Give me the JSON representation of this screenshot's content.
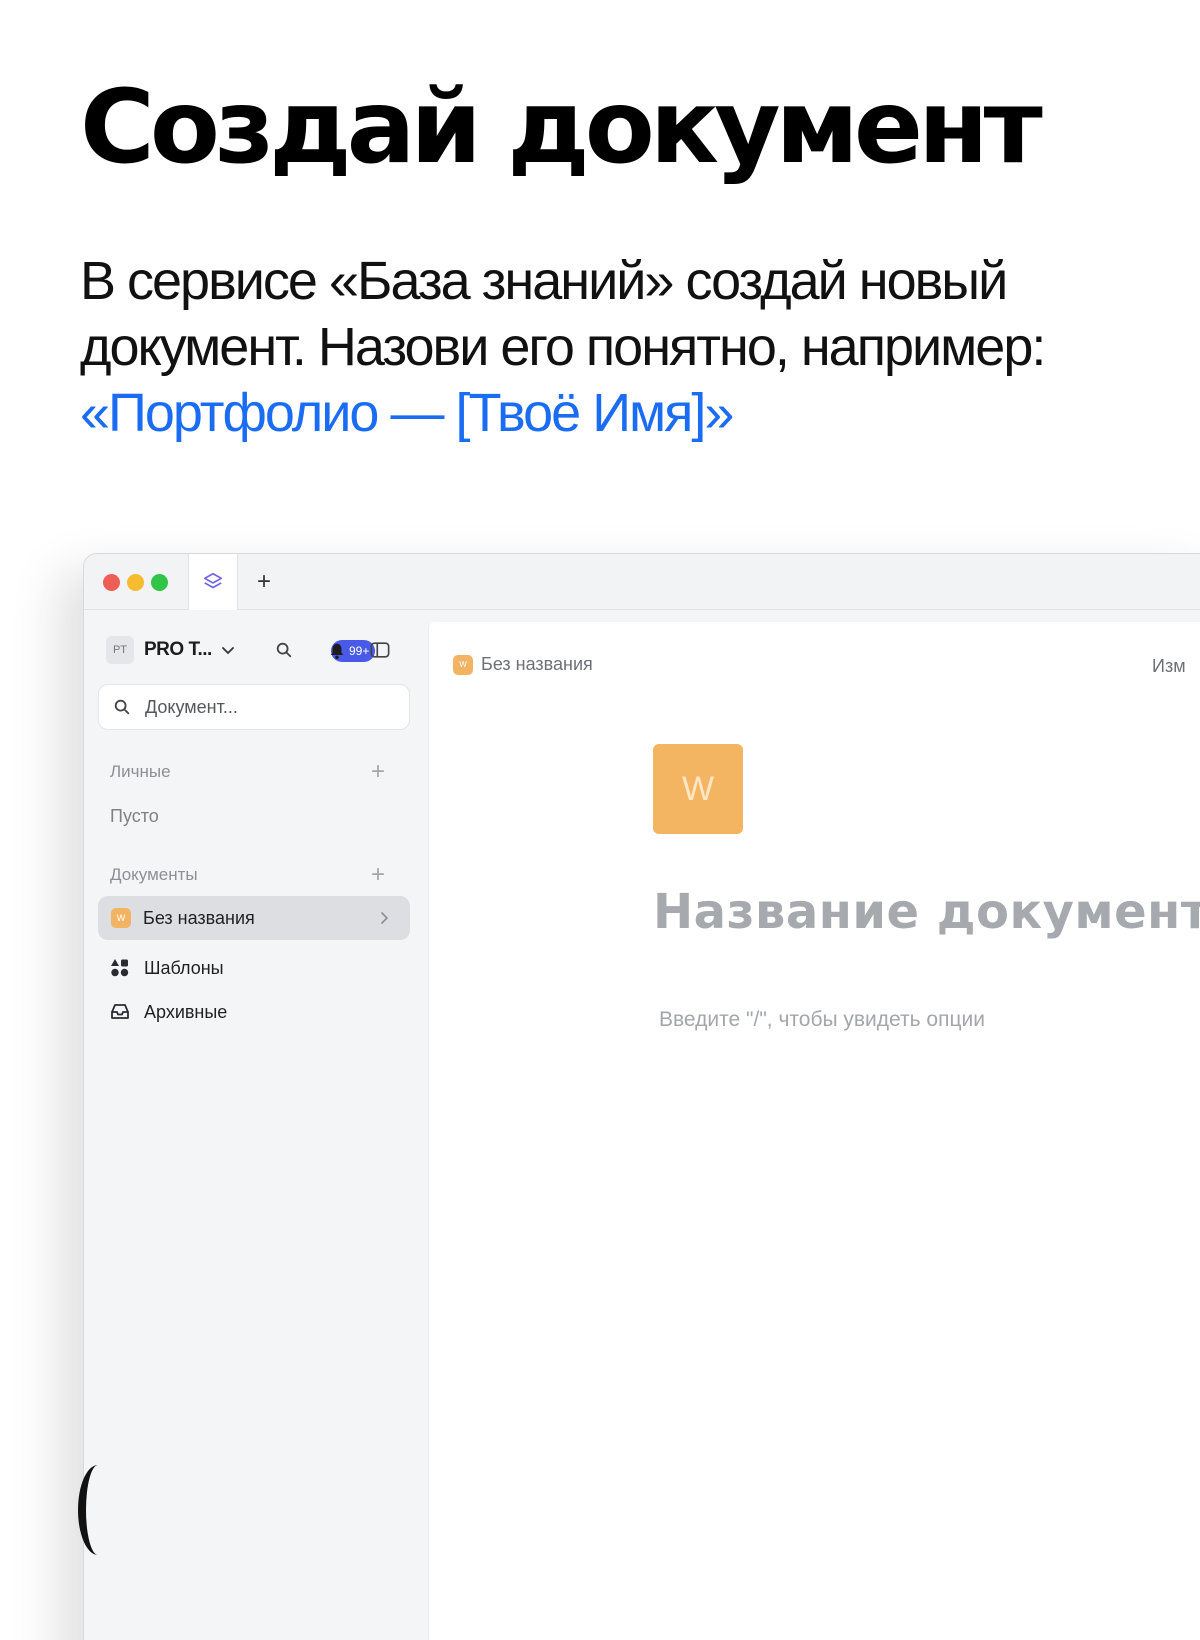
{
  "heading": "Создай документ",
  "lead": {
    "text": "В сервисе «База знаний» создай новый документ. Назови его понятно, например:",
    "accent": "«Портфолио — [Твоё Имя]»",
    "accent_color": "#1a6cf3"
  },
  "window": {
    "tab_icon": "layers-icon",
    "new_tab_label": "+"
  },
  "sidebar": {
    "workspace": {
      "avatar": "PT",
      "name": "PRO T..."
    },
    "notifications_badge": "99+",
    "search_placeholder": "Документ...",
    "personal": {
      "title": "Личные",
      "empty": "Пусто"
    },
    "documents": {
      "title": "Документы",
      "items": [
        {
          "badge": "W",
          "label": "Без названия"
        }
      ]
    },
    "nav": [
      {
        "icon": "templates-icon",
        "label": "Шаблоны"
      },
      {
        "icon": "archive-icon",
        "label": "Архивные"
      }
    ],
    "plus_label": "+"
  },
  "main": {
    "breadcrumb": {
      "badge": "W",
      "label": "Без названия"
    },
    "breadcrumb_right": "Изм",
    "doc_icon_letter": "W",
    "title_placeholder": "Название документ",
    "hint": "Введите \"/\", чтобы увидеть опции"
  },
  "colors": {
    "accent": "#1a6cf3",
    "doc_badge": "#f2b463",
    "notification_badge": "#4a5ae8"
  }
}
